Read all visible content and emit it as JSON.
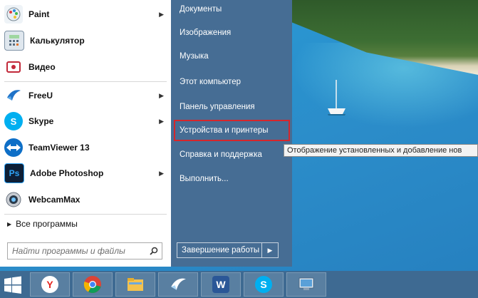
{
  "start_menu": {
    "programs": [
      {
        "label": "Paint",
        "icon": "paint-icon",
        "arrow": true
      },
      {
        "label": "Калькулятор",
        "icon": "calculator-icon",
        "arrow": false
      },
      {
        "label": "Видео",
        "icon": "video-icon",
        "arrow": false
      },
      {
        "label": "FreeU",
        "icon": "freeu-icon",
        "arrow": true
      },
      {
        "label": "Skype",
        "icon": "skype-icon",
        "arrow": true
      },
      {
        "label": "TeamViewer 13",
        "icon": "teamviewer-icon",
        "arrow": false
      },
      {
        "label": "Adobe Photoshop",
        "icon": "photoshop-icon",
        "arrow": true
      },
      {
        "label": "WebcamMax",
        "icon": "webcammax-icon",
        "arrow": false
      }
    ],
    "all_programs": "Все программы",
    "search_placeholder": "Найти программы и файлы",
    "right_items": [
      "Документы",
      "Изображения",
      "Музыка",
      "Этот компьютер",
      "Панель управления",
      "Устройства и принтеры",
      "Справка и поддержка",
      "Выполнить..."
    ],
    "shutdown_label": "Завершение работы",
    "tooltip": "Отображение установленных и добавление нов",
    "highlight_color": "#d6262b",
    "right_panel_color": "#466d94"
  },
  "taskbar": {
    "items": [
      "yandex-browser-icon",
      "chrome-icon",
      "file-explorer-icon",
      "freeu-icon",
      "word-icon",
      "skype-icon",
      "control-panel-icon"
    ],
    "color": "#3e6a92"
  }
}
